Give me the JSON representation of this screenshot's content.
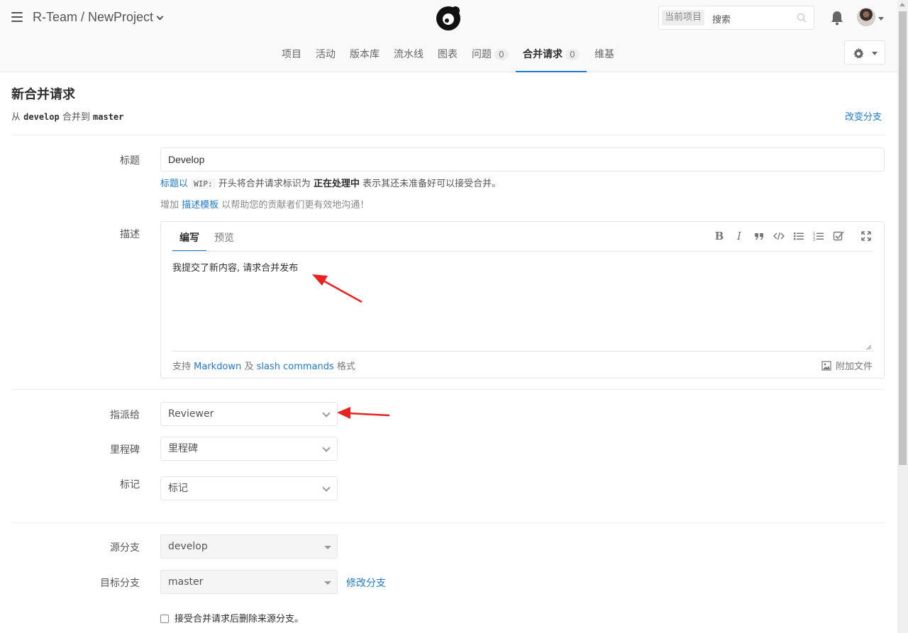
{
  "header": {
    "project_title": "R-Team / NewProject",
    "search_scope": "当前项目",
    "search_placeholder": "搜索"
  },
  "nav": {
    "items": [
      {
        "label": "项目"
      },
      {
        "label": "活动"
      },
      {
        "label": "版本库"
      },
      {
        "label": "流水线"
      },
      {
        "label": "图表"
      },
      {
        "label": "问题",
        "count": "0"
      },
      {
        "label": "合并请求",
        "count": "0"
      },
      {
        "label": "维基"
      }
    ]
  },
  "page": {
    "title": "新合并请求",
    "from_label": "从",
    "source_branch": "develop",
    "merge_to_label": "合并到",
    "target_branch": "master",
    "change_branch": "改变分支"
  },
  "form": {
    "title_label": "标题",
    "title_value": "Develop",
    "hint_prefix_link": "标题以",
    "hint_code": "WIP:",
    "hint_mid": "开头将合并请求标识为",
    "hint_bold": "正在处理中",
    "hint_suffix": "表示其还未准备好可以接受合并。",
    "template_prefix": "增加",
    "template_link": "描述模板",
    "template_suffix": "以帮助您的贡献者们更有效地沟通！",
    "desc_label": "描述",
    "tab_write": "编写",
    "tab_preview": "预览",
    "desc_value": "我提交了新内容, 请求合并发布",
    "footer_prefix": "支持",
    "footer_markdown": "Markdown",
    "footer_and": "及",
    "footer_slash": "slash commands",
    "footer_suffix": "格式",
    "attach_file": "附加文件",
    "assignee_label": "指派给",
    "assignee_value": "Reviewer",
    "milestone_label": "里程碑",
    "milestone_value": "里程碑",
    "labels_label": "标记",
    "labels_value": "标记",
    "source_label": "源分支",
    "source_value": "develop",
    "target_label": "目标分支",
    "target_value": "master",
    "edit_branch": "修改分支",
    "remove_source": "接受合并请求后删除来源分支。"
  },
  "colors": {
    "link": "#1f78d1",
    "annotation_arrow": "#e8231f"
  }
}
